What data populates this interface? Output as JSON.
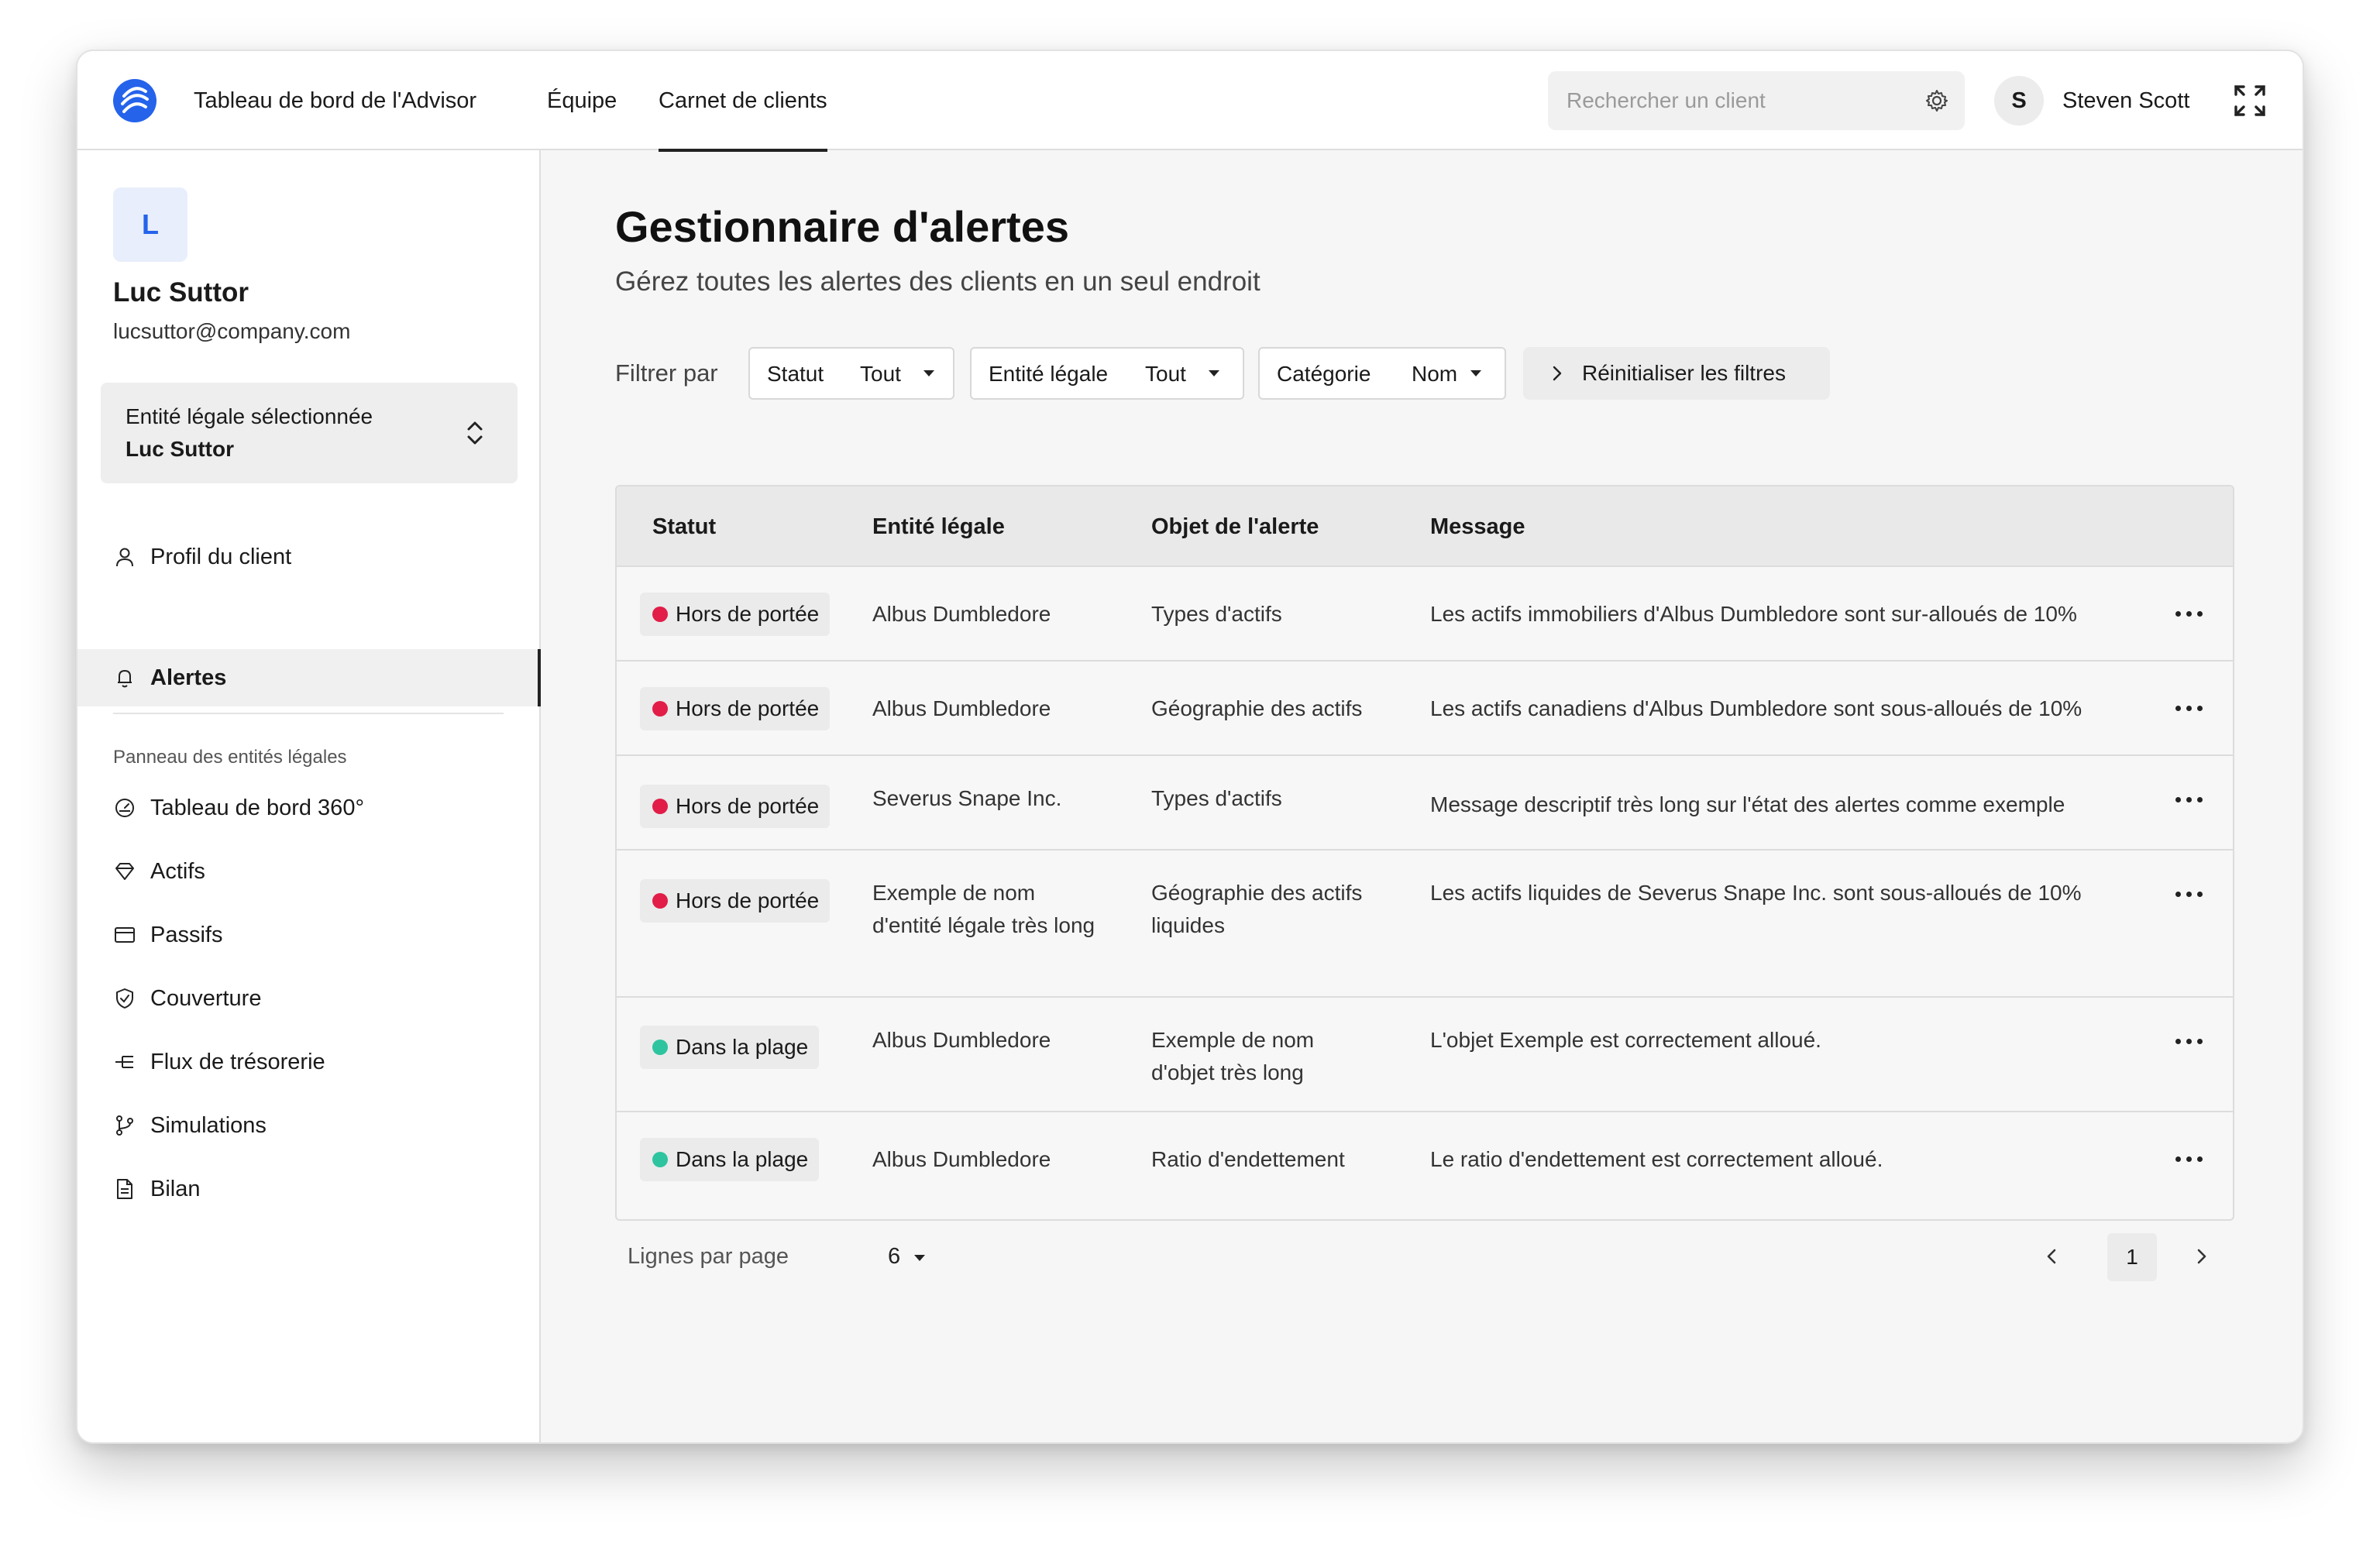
{
  "topbar": {
    "nav": [
      "Tableau de bord de l'Advisor",
      "Équipe",
      "Carnet de clients"
    ],
    "active_nav": "Carnet de clients",
    "search_placeholder": "Rechercher un client",
    "user_initial": "S",
    "user_name": "Steven Scott"
  },
  "sidebar": {
    "client_initial": "L",
    "client_name": "Luc Suttor",
    "client_email": "lucsuttor@company.com",
    "entity_label": "Entité légale sélectionnée",
    "entity_value": "Luc Suttor",
    "primary_items": [
      {
        "label": "Profil du client",
        "icon": "user-icon"
      },
      {
        "label": "Alertes",
        "icon": "bell-icon",
        "active": true
      }
    ],
    "section_title": "Panneau des entités légales",
    "section_items": [
      {
        "label": "Tableau de bord 360°",
        "icon": "gauge-icon"
      },
      {
        "label": "Actifs",
        "icon": "diamond-icon"
      },
      {
        "label": "Passifs",
        "icon": "credit-card-icon"
      },
      {
        "label": "Couverture",
        "icon": "shield-icon"
      },
      {
        "label": "Flux de trésorerie",
        "icon": "flow-icon"
      },
      {
        "label": "Simulations",
        "icon": "branch-icon"
      },
      {
        "label": "Bilan",
        "icon": "document-icon"
      }
    ]
  },
  "main": {
    "title": "Gestionnaire d'alertes",
    "subtitle": "Gérez toutes les alertes des clients en un seul endroit",
    "filter_label": "Filtrer par",
    "filters": [
      {
        "key": "Statut",
        "value": "Tout"
      },
      {
        "key": "Entité légale",
        "value": "Tout"
      },
      {
        "key": "Catégorie",
        "value": "Nom"
      }
    ],
    "reset_label": "Réinitialiser les filtres"
  },
  "table": {
    "headers": [
      "Statut",
      "Entité légale",
      "Objet de l'alerte",
      "Message"
    ],
    "rows": [
      {
        "status": "Hors de portée",
        "entity": "Albus Dumbledore",
        "object": "Types d'actifs",
        "message": "Les actifs immobiliers d'Albus Dumbledore sont sur-alloués de 10%"
      },
      {
        "status": "Hors de portée",
        "entity": "Albus Dumbledore",
        "object": "Géographie des actifs",
        "message": "Les actifs canadiens d'Albus Dumbledore sont sous-alloués de 10%"
      },
      {
        "status": "Hors de portée",
        "entity": "Severus Snape Inc.",
        "object": "Types d'actifs",
        "message": "Message descriptif très long sur l'état des alertes comme exemple"
      },
      {
        "status": "Hors de portée",
        "entity": "Exemple de nom d'entité légale très long",
        "object": "Géographie des actifs liquides",
        "message": "Les actifs liquides de Severus Snape Inc. sont sous-alloués de 10%"
      },
      {
        "status": "Dans la plage",
        "entity": "Albus Dumbledore",
        "object": "Exemple de nom d'objet très long",
        "message": "L'objet Exemple est correctement alloué."
      },
      {
        "status": "Dans la plage",
        "entity": "Albus Dumbledore",
        "object": "Ratio d'endettement",
        "message": "Le ratio d'endettement est correctement alloué."
      }
    ]
  },
  "pagination": {
    "rows_per_page_label": "Lignes par page",
    "rows_per_page": "6",
    "current_page": "1"
  },
  "colors": {
    "alert_red": "#e11d48",
    "ok_green": "#2ec4a0",
    "brand_blue": "#2563eb"
  }
}
